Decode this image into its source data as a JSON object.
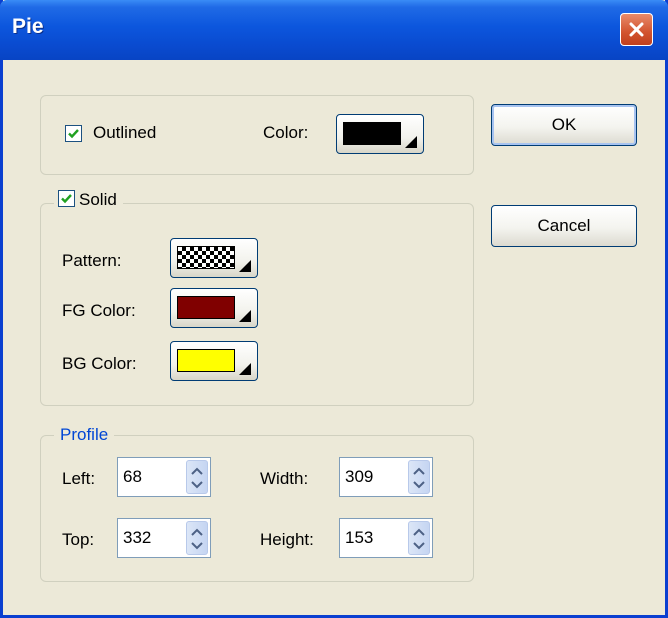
{
  "window": {
    "title": "Pie",
    "close_icon": "close-x-icon"
  },
  "outline": {
    "outlined_label": "Outlined",
    "outlined_checked": true,
    "color_label": "Color:",
    "color": "#000000"
  },
  "solid": {
    "solid_label": "Solid",
    "solid_checked": true,
    "pattern_label": "Pattern:",
    "pattern": "checkerboard",
    "fg_label": "FG Color:",
    "fg_color": "#800000",
    "bg_label": "BG Color:",
    "bg_color": "#ffff00"
  },
  "profile": {
    "legend": "Profile",
    "left_label": "Left:",
    "left": "68",
    "top_label": "Top:",
    "top": "332",
    "width_label": "Width:",
    "width": "309",
    "height_label": "Height:",
    "height": "153"
  },
  "buttons": {
    "ok": "OK",
    "cancel": "Cancel"
  }
}
